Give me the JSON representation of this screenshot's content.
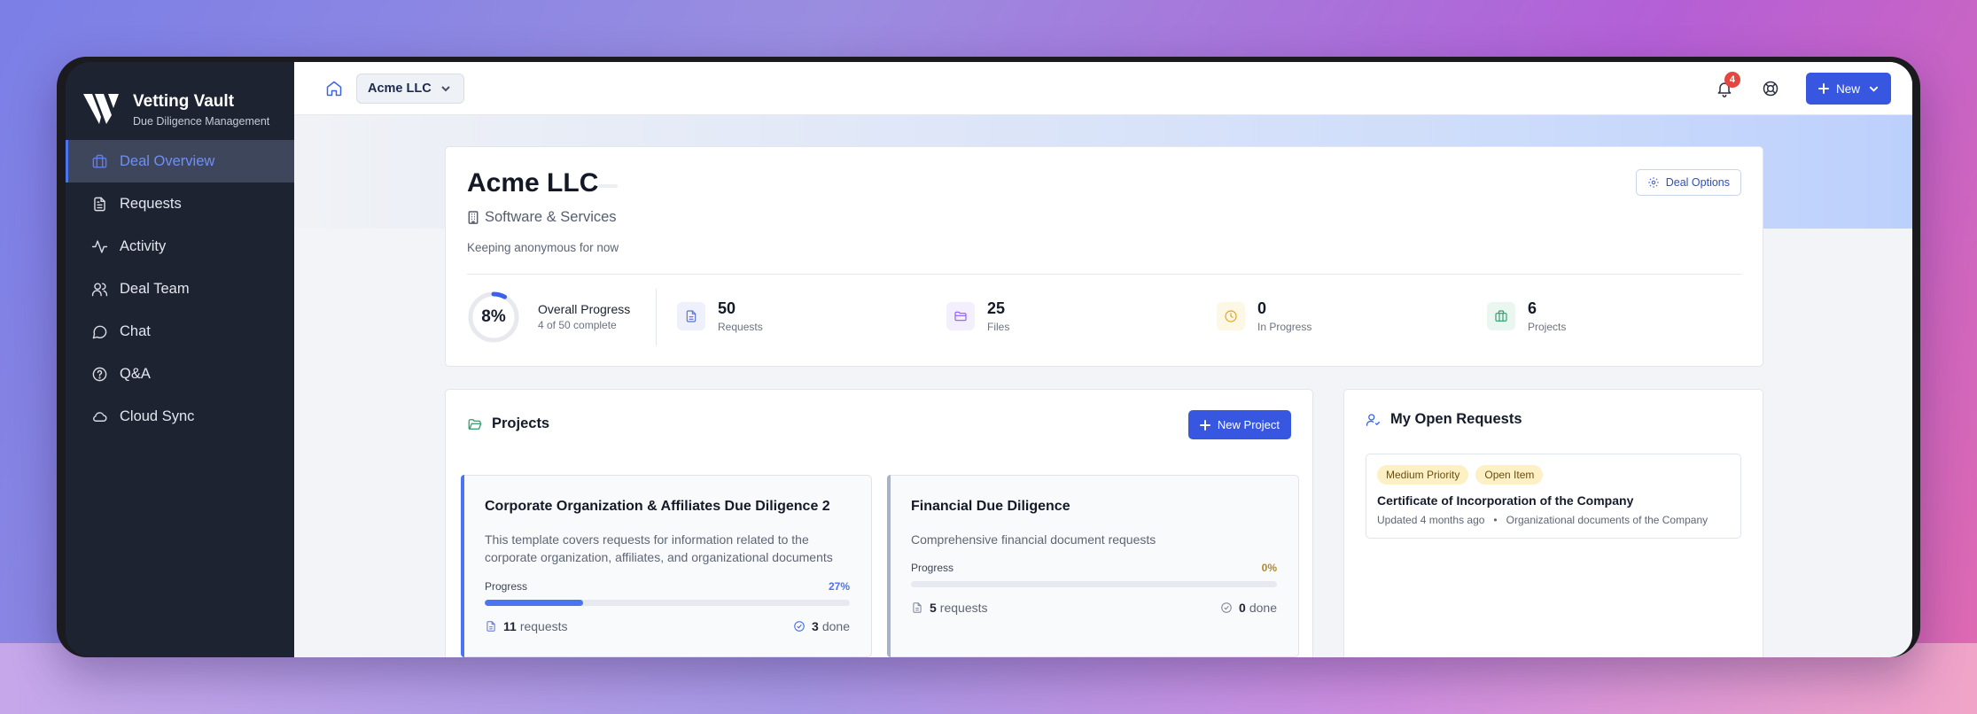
{
  "app": {
    "name": "Vetting Vault",
    "subtitle": "Due Diligence Management"
  },
  "sidebar": {
    "items": [
      {
        "label": "Deal Overview",
        "icon": "briefcase-icon",
        "active": true
      },
      {
        "label": "Requests",
        "icon": "document-icon"
      },
      {
        "label": "Activity",
        "icon": "activity-icon"
      },
      {
        "label": "Deal Team",
        "icon": "users-icon"
      },
      {
        "label": "Chat",
        "icon": "chat-icon"
      },
      {
        "label": "Q&A",
        "icon": "help-circle-icon"
      },
      {
        "label": "Cloud Sync",
        "icon": "cloud-icon"
      }
    ]
  },
  "topbar": {
    "deal_selector": "Acme LLC",
    "notifications_count": "4",
    "new_label": "New"
  },
  "deal": {
    "name": "Acme LLC",
    "industry": "Software & Services",
    "description": "Keeping anonymous for now",
    "options_label": "Deal Options",
    "progress": {
      "percent_text": "8%",
      "percent": 8,
      "label": "Overall Progress",
      "sub": "4 of 50 complete"
    },
    "stats": [
      {
        "value": "50",
        "label": "Requests",
        "color": "#5b6fd6",
        "bg": "#eef1fb",
        "icon": "document-icon"
      },
      {
        "value": "25",
        "label": "Files",
        "color": "#8b5cf6",
        "bg": "#f3effc",
        "icon": "folder-icon"
      },
      {
        "value": "0",
        "label": "In Progress",
        "color": "#e0a21b",
        "bg": "#fdf7e6",
        "icon": "clock-icon"
      },
      {
        "value": "6",
        "label": "Projects",
        "color": "#2f9a6b",
        "bg": "#eaf6f0",
        "icon": "briefcase-icon"
      }
    ]
  },
  "projects": {
    "title": "Projects",
    "new_label": "New Project",
    "progress_label": "Progress",
    "requests_word": "requests",
    "done_word": "done",
    "items": [
      {
        "title": "Corporate Organization & Affiliates Due Diligence 2",
        "desc_line1": "This template covers requests for information related to the",
        "desc_line2": "corporate organization, affiliates, and organizational documents",
        "percent_text": "27%",
        "percent": 27,
        "requests": "11",
        "done": "3",
        "accent": "#4a74f0"
      },
      {
        "title": "Financial Due Diligence",
        "desc_line1": "Comprehensive financial document requests",
        "desc_line2": "",
        "percent_text": "0%",
        "percent": 0,
        "requests": "5",
        "done": "0",
        "accent": "#a9b3c8"
      }
    ]
  },
  "open_requests": {
    "title": "My Open Requests",
    "items": [
      {
        "tags": [
          "Medium Priority",
          "Open Item"
        ],
        "title": "Certificate of Incorporation of the Company",
        "updated": "Updated 4 months ago",
        "category": "Organizational documents of the Company"
      }
    ]
  }
}
